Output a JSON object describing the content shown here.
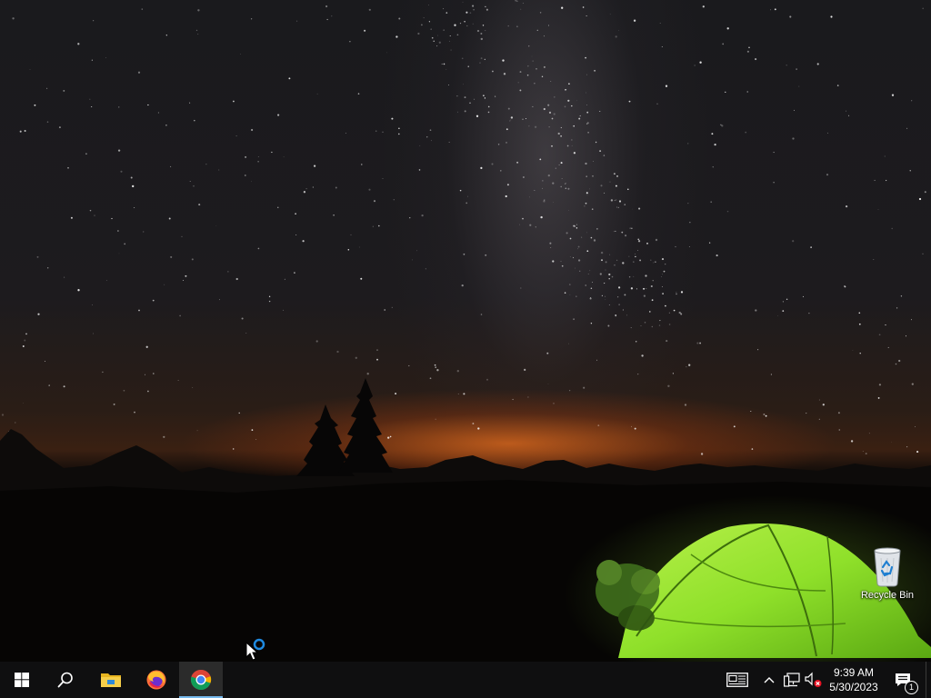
{
  "desktop": {
    "icons": [
      {
        "label": "Recycle Bin",
        "icon": "recycle-bin-icon"
      }
    ]
  },
  "taskbar": {
    "start": {
      "icon": "windows-logo-icon"
    },
    "search": {
      "icon": "search-icon"
    },
    "pinned_apps": [
      {
        "icon": "file-explorer-icon",
        "active": false
      },
      {
        "icon": "firefox-icon",
        "active": false
      },
      {
        "icon": "chrome-icon",
        "active": true
      }
    ],
    "tray": {
      "icons": [
        "news-widget-icon",
        "chevron-up-icon",
        "network-icon",
        "volume-muted-icon"
      ],
      "clock": {
        "time": "9:39 AM",
        "date": "5/30/2023"
      },
      "notifications": {
        "icon": "action-center-icon",
        "count": "1"
      }
    }
  },
  "colors": {
    "taskbar_bg": "#0f0f10",
    "active_indicator": "#76b9ed",
    "tent_green": "#8fe02a",
    "horizon_glow": "#e86e1e"
  }
}
